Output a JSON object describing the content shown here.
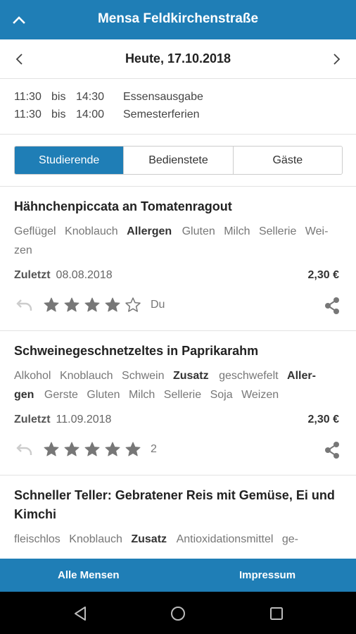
{
  "appbar": {
    "title": "Mensa Feldkirchenstraße"
  },
  "datebar": {
    "date": "Heute, 17.10.2018"
  },
  "hours": [
    {
      "from": "11:30",
      "bis": "bis",
      "to": "14:30",
      "desc": "Essensausgabe"
    },
    {
      "from": "11:30",
      "bis": "bis",
      "to": "14:00",
      "desc": "Semesterferien"
    }
  ],
  "tabs": [
    "Studierende",
    "Bedienstete",
    "Gäste"
  ],
  "meals": [
    {
      "title": "Hähnchenpiccata an Tomatenragout",
      "line1": {
        "a": "Geflügel",
        "b": "Knoblauch",
        "bold": "Allergen",
        "c": "Gluten",
        "d": "Milch",
        "e": "Sellerie",
        "f": "Wei-"
      },
      "line2": "zen",
      "last_label": "Zuletzt",
      "last_date": "08.08.2018",
      "price": "2,30 €",
      "rating": 4,
      "rating_text": "Du"
    },
    {
      "title": "Schweinegeschnetzeltes in Paprikarahm",
      "line1": {
        "a": "Alkohol",
        "b": "Knoblauch",
        "c": "Schwein",
        "bold1": "Zusatz",
        "d": "geschwefelt",
        "bold2": "Aller-"
      },
      "line2": {
        "bold": "gen",
        "a": "Gerste",
        "b": "Gluten",
        "c": "Milch",
        "d": "Sellerie",
        "e": "Soja",
        "f": "Weizen"
      },
      "last_label": "Zuletzt",
      "last_date": "11.09.2018",
      "price": "2,30 €",
      "rating": 5,
      "rating_text": "2"
    },
    {
      "title": "Schneller Teller: Gebratener Reis mit Gemüse, Ei und Kimchi",
      "line1": {
        "a": "fleischlos",
        "b": "Knoblauch",
        "bold": "Zusatz",
        "c": "Antioxidationsmittel",
        "d": "ge-"
      }
    }
  ],
  "bottombar": {
    "left": "Alle Mensen",
    "right": "Impressum"
  },
  "colors": {
    "primary": "#1f7eb6",
    "star": "#777777"
  },
  "icons": [
    "chevron-up-icon",
    "chevron-left-icon",
    "chevron-right-icon",
    "undo-icon",
    "star-icon",
    "share-icon",
    "back-icon",
    "home-icon",
    "recents-icon"
  ]
}
